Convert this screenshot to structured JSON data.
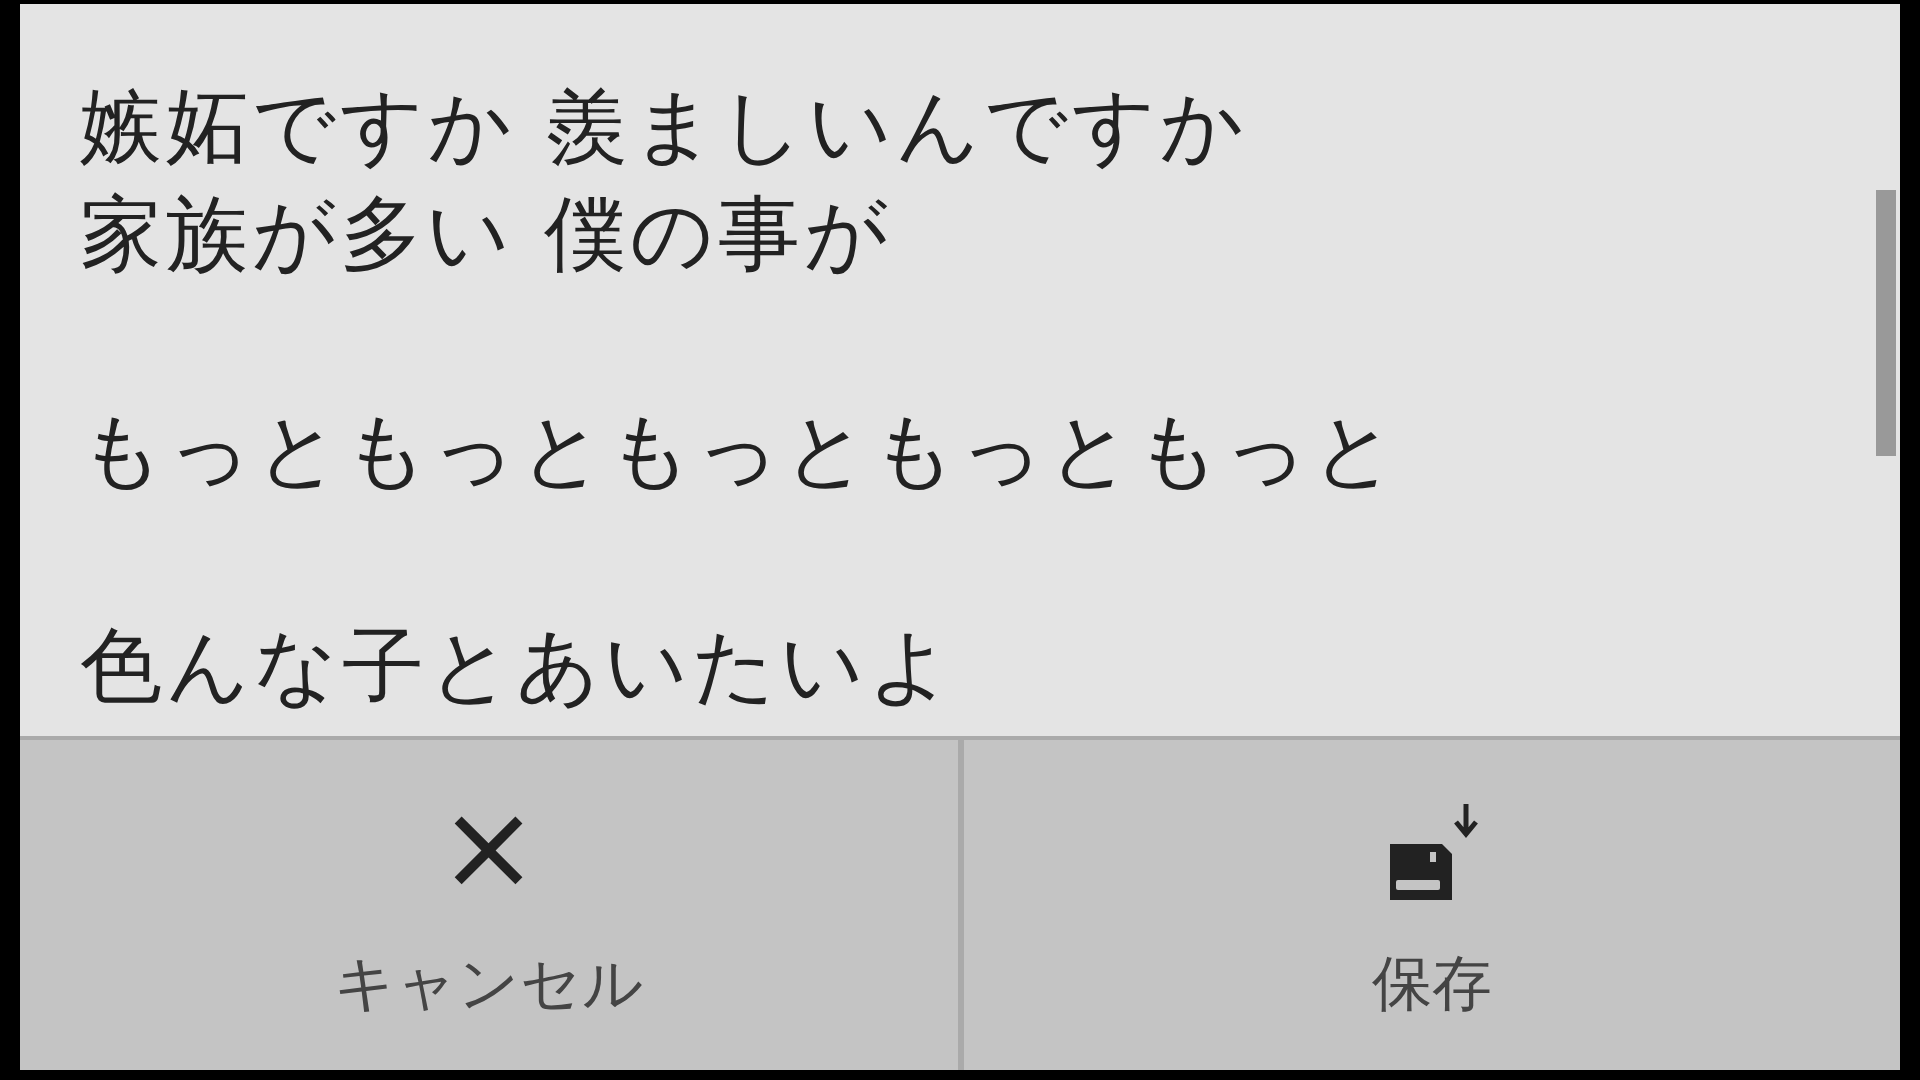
{
  "lyrics": {
    "paragraphs": [
      [
        "嫉妬ですか 羨ましいんですか",
        "家族が多い 僕の事が"
      ],
      [
        "もっともっともっともっともっと"
      ],
      [
        "色んな子とあいたいよ"
      ]
    ]
  },
  "buttons": [
    {
      "kind": "cancel",
      "label": "キャンセル",
      "icon": "×"
    },
    {
      "kind": "save",
      "label": "保存"
    }
  ]
}
